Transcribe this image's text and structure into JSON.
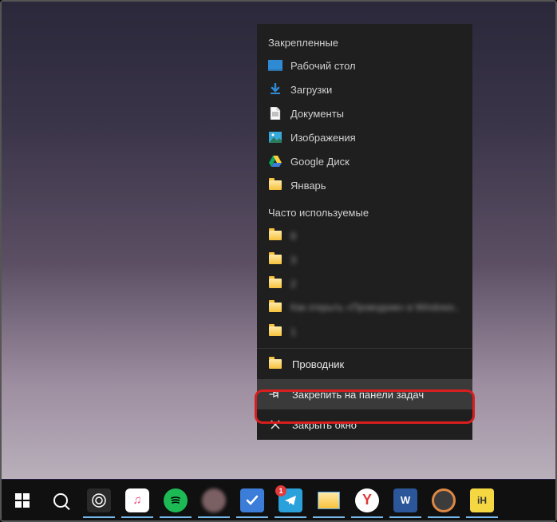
{
  "jumplist": {
    "pinned_header": "Закрепленные",
    "pinned": [
      {
        "label": "Рабочий стол",
        "icon": "desktop-icon"
      },
      {
        "label": "Загрузки",
        "icon": "download-icon"
      },
      {
        "label": "Документы",
        "icon": "document-icon"
      },
      {
        "label": "Изображения",
        "icon": "image-icon"
      },
      {
        "label": "Google Диск",
        "icon": "gdrive-icon"
      },
      {
        "label": "Январь",
        "icon": "folder-icon"
      }
    ],
    "frequent_header": "Часто используемые",
    "frequent": [
      {
        "label": "6",
        "blurred": true
      },
      {
        "label": "3",
        "blurred": true
      },
      {
        "label": "2",
        "blurred": true
      },
      {
        "label": "Как открыть «Проводник» в Windows..",
        "blurred": true
      },
      {
        "label": "1",
        "blurred": true
      }
    ],
    "actions": {
      "app_label": "Проводник",
      "pin_label": "Закрепить на панели задач",
      "close_label": "Закрыть окно"
    }
  },
  "taskbar": {
    "telegram_badge": "1"
  }
}
